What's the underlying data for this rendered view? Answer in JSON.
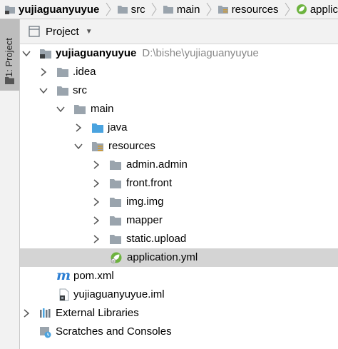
{
  "navbar": {
    "crumbs": [
      {
        "label": "yujiaguanyuyue",
        "icon": "folder-icon"
      },
      {
        "label": "src",
        "icon": "folder-icon"
      },
      {
        "label": "main",
        "icon": "folder-icon"
      },
      {
        "label": "resources",
        "icon": "resources-folder-icon"
      },
      {
        "label": "applic",
        "icon": "spring-icon"
      }
    ]
  },
  "toolwindow": {
    "tab_label": "1: Project"
  },
  "panel": {
    "title": "Project",
    "dropdown_icon": "chevron-down-icon"
  },
  "tree": {
    "root": {
      "name": "yujiaguanyuyue",
      "path": "D:\\bishe\\yujiaguanyuyue"
    },
    "idea": ".idea",
    "src": "src",
    "main": "main",
    "java": "java",
    "resources": "resources",
    "admin": "admin.admin",
    "front": "front.front",
    "img": "img.img",
    "mapper": "mapper",
    "static": "static.upload",
    "application": "application.yml",
    "pom": "pom.xml",
    "iml": "yujiaguanyuyue.iml",
    "external": "External Libraries",
    "scratches": "Scratches and Consoles"
  },
  "colors": {
    "folder": "#9aa4ad",
    "source_folder": "#4aa3df",
    "spring": "#6db33f",
    "maven": "#2d7fd3",
    "selection": "#d4d4d4"
  }
}
